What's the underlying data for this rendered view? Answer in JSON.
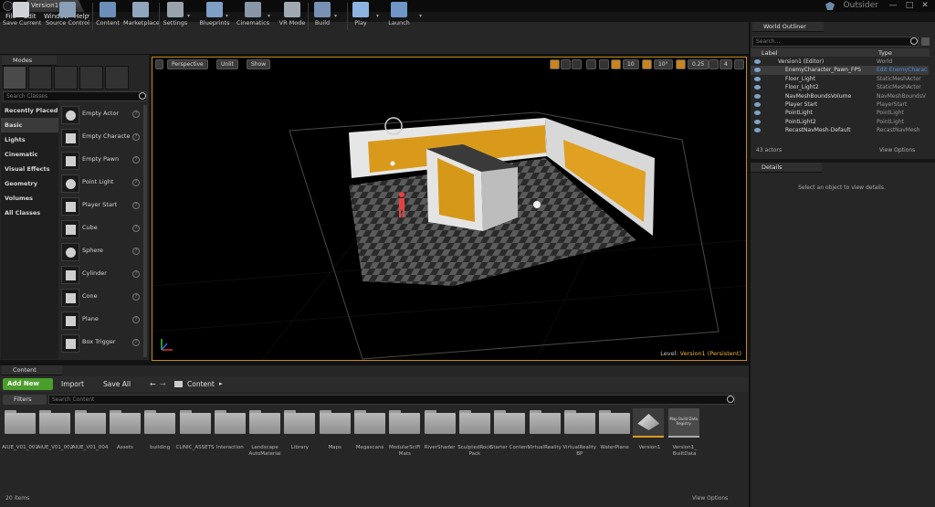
{
  "window": {
    "tab_title": "Version1*",
    "project": "Outsider",
    "min": "—",
    "max": "□",
    "close": "✕"
  },
  "menu": [
    "File",
    "Edit",
    "Window",
    "Help"
  ],
  "toolbar": [
    {
      "label": "Save Current",
      "icon": "save-icon",
      "color": "#cfd3d8"
    },
    {
      "label": "Source Control",
      "icon": "source-control-icon",
      "color": "#8aa0b8"
    },
    {
      "label": "Content",
      "icon": "content-icon",
      "color": "#6c8fb9"
    },
    {
      "label": "Marketplace",
      "icon": "marketplace-icon",
      "color": "#8fa6bd"
    },
    {
      "label": "Settings",
      "icon": "settings-icon",
      "color": "#98a3ad"
    },
    {
      "label": "Blueprints",
      "icon": "blueprints-icon",
      "color": "#7f9fc4"
    },
    {
      "label": "Cinematics",
      "icon": "cinematics-icon",
      "color": "#8896a8"
    },
    {
      "label": "VR Mode",
      "icon": "vr-mode-icon",
      "color": "#a0a8b2"
    },
    {
      "label": "Build",
      "icon": "build-icon",
      "color": "#7890b4"
    },
    {
      "label": "Play",
      "icon": "play-icon",
      "color": "#8fb3e0"
    },
    {
      "label": "Launch",
      "icon": "launch-icon",
      "color": "#6f96c6"
    }
  ],
  "modes": {
    "tab": "Modes",
    "search_placeholder": "Search Classes",
    "categories": [
      "Recently Placed",
      "Basic",
      "Lights",
      "Cinematic",
      "Visual Effects",
      "Geometry",
      "Volumes",
      "All Classes"
    ],
    "active_category": "Basic",
    "items": [
      "Empty Actor",
      "Empty Character",
      "Empty Pawn",
      "Point Light",
      "Player Start",
      "Cube",
      "Sphere",
      "Cylinder",
      "Cone",
      "Plane",
      "Box Trigger"
    ],
    "help": "?"
  },
  "viewport": {
    "perspective": "Perspective",
    "lit": "Unlit",
    "show": "Show",
    "grid": "10",
    "angle": "10°",
    "scale": "0.25",
    "cam": "4",
    "level_prefix": "Level:",
    "level_name": "Version1 (Persistent)"
  },
  "content_browser": {
    "tab": "Content Browser",
    "add_new": "Add New",
    "import": "Import",
    "save_all": "Save All",
    "path": "Content",
    "filters": "Filters",
    "search_placeholder": "Search Content",
    "assets": [
      {
        "name": "AIUE_V01_001",
        "kind": "folder"
      },
      {
        "name": "AIUE_V01_002",
        "kind": "folder"
      },
      {
        "name": "AIUE_V01_004",
        "kind": "folder"
      },
      {
        "name": "Assets",
        "kind": "folder"
      },
      {
        "name": "building",
        "kind": "folder"
      },
      {
        "name": "CLINIC_ASSETS",
        "kind": "folder"
      },
      {
        "name": "Interaction",
        "kind": "folder"
      },
      {
        "name": "Landscape AutoMaterial",
        "kind": "folder"
      },
      {
        "name": "Library",
        "kind": "folder"
      },
      {
        "name": "Maps",
        "kind": "folder"
      },
      {
        "name": "Megascans",
        "kind": "folder"
      },
      {
        "name": "ModularSciFi Mats",
        "kind": "folder"
      },
      {
        "name": "RiverShader",
        "kind": "folder"
      },
      {
        "name": "SculptedRock Pack",
        "kind": "folder"
      },
      {
        "name": "Starter Content",
        "kind": "folder"
      },
      {
        "name": "VirtualReality",
        "kind": "folder"
      },
      {
        "name": "VirtualReality BP",
        "kind": "folder"
      },
      {
        "name": "WaterPlane",
        "kind": "folder"
      },
      {
        "name": "Version1",
        "kind": "level"
      },
      {
        "name": "Version1_ BuiltData",
        "kind": "data",
        "thumb": "Map Build Data Registry"
      }
    ],
    "count": "20 items",
    "view_options": "View Options"
  },
  "outliner": {
    "tab": "World Outliner",
    "search_placeholder": "Search...",
    "col_label": "Label",
    "col_type": "Type",
    "rows": [
      {
        "label": "Version1 (Editor)",
        "type": "World",
        "link": false
      },
      {
        "label": "EnemyCharacter_Pawn_FPS",
        "type": "Edit EnemyCharac",
        "link": true
      },
      {
        "label": "Floor_Light",
        "type": "StaticMeshActor",
        "link": false
      },
      {
        "label": "Floor_Light2",
        "type": "StaticMeshActor",
        "link": false
      },
      {
        "label": "NavMeshBoundsVolume",
        "type": "NavMeshBoundsV",
        "link": false
      },
      {
        "label": "Player Start",
        "type": "PlayerStart",
        "link": false
      },
      {
        "label": "PointLight",
        "type": "PointLight",
        "link": false
      },
      {
        "label": "PointLight2",
        "type": "PointLight",
        "link": false
      },
      {
        "label": "RecastNavMesh-Default",
        "type": "RecastNavMesh",
        "link": false
      }
    ],
    "count": "43 actors",
    "view_options": "View Options"
  },
  "details": {
    "tab": "Details",
    "hint": "Select an object to view details."
  }
}
